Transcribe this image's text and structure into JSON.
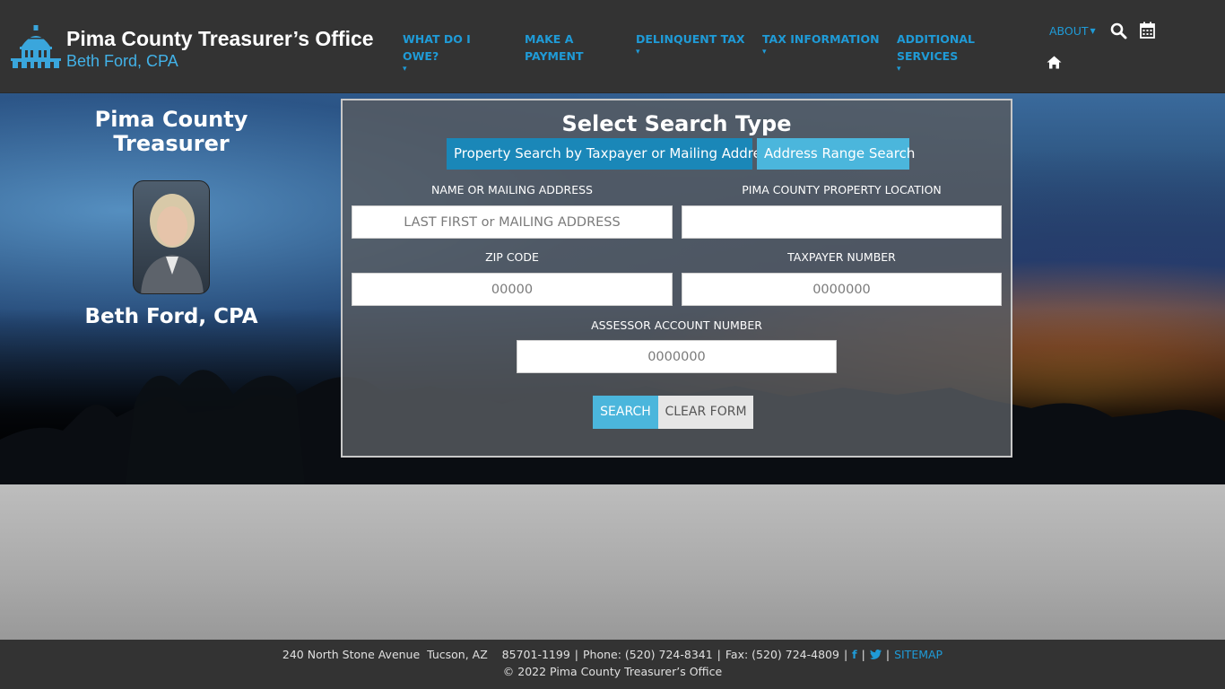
{
  "brand": {
    "title": "Pima County Treasurer’s Office",
    "subtitle": "Beth Ford, CPA"
  },
  "nav": {
    "items": [
      {
        "label": "WHAT DO I OWE?",
        "has_dropdown": true
      },
      {
        "label": "MAKE A PAYMENT",
        "has_dropdown": false
      },
      {
        "label": "DELINQUENT TAX",
        "has_dropdown": true
      },
      {
        "label": "TAX INFORMATION",
        "has_dropdown": true
      },
      {
        "label": "ADDITIONAL SERVICES",
        "has_dropdown": true
      }
    ],
    "about_label": "ABOUT",
    "icons": [
      "search-icon",
      "calendar-icon",
      "home-icon"
    ]
  },
  "sidebar": {
    "title": "Pima County Treasurer",
    "name": "Beth Ford, CPA"
  },
  "search": {
    "heading": "Select Search Type",
    "tabs": [
      "Property Search by Taxpayer or Mailing Address",
      "Address Range Search"
    ],
    "fields": {
      "name_label": "NAME OR MAILING ADDRESS",
      "name_placeholder": "LAST FIRST or MAILING ADDRESS",
      "location_label": "PIMA COUNTY PROPERTY LOCATION",
      "location_placeholder": "",
      "zip_label": "ZIP CODE",
      "zip_placeholder": "00000",
      "taxpayer_label": "TAXPAYER NUMBER",
      "taxpayer_placeholder": "0000000",
      "assessor_label": "ASSESSOR ACCOUNT NUMBER",
      "assessor_placeholder": "0000000"
    },
    "search_button": "SEARCH",
    "clear_button": "CLEAR FORM"
  },
  "footer": {
    "address": "240 North Stone Avenue  Tucson, AZ    85701-1199",
    "phone": "Phone: (520) 724-8341",
    "fax": "Fax: (520) 724-4809",
    "sitemap": "SITEMAP",
    "copyright": "© 2022 Pima County Treasurer’s Office"
  },
  "colors": {
    "header_bg": "#333333",
    "accent_blue": "#1f9bd7",
    "tab_active": "#1a87b8",
    "tab_inactive": "#4bb6dc"
  }
}
